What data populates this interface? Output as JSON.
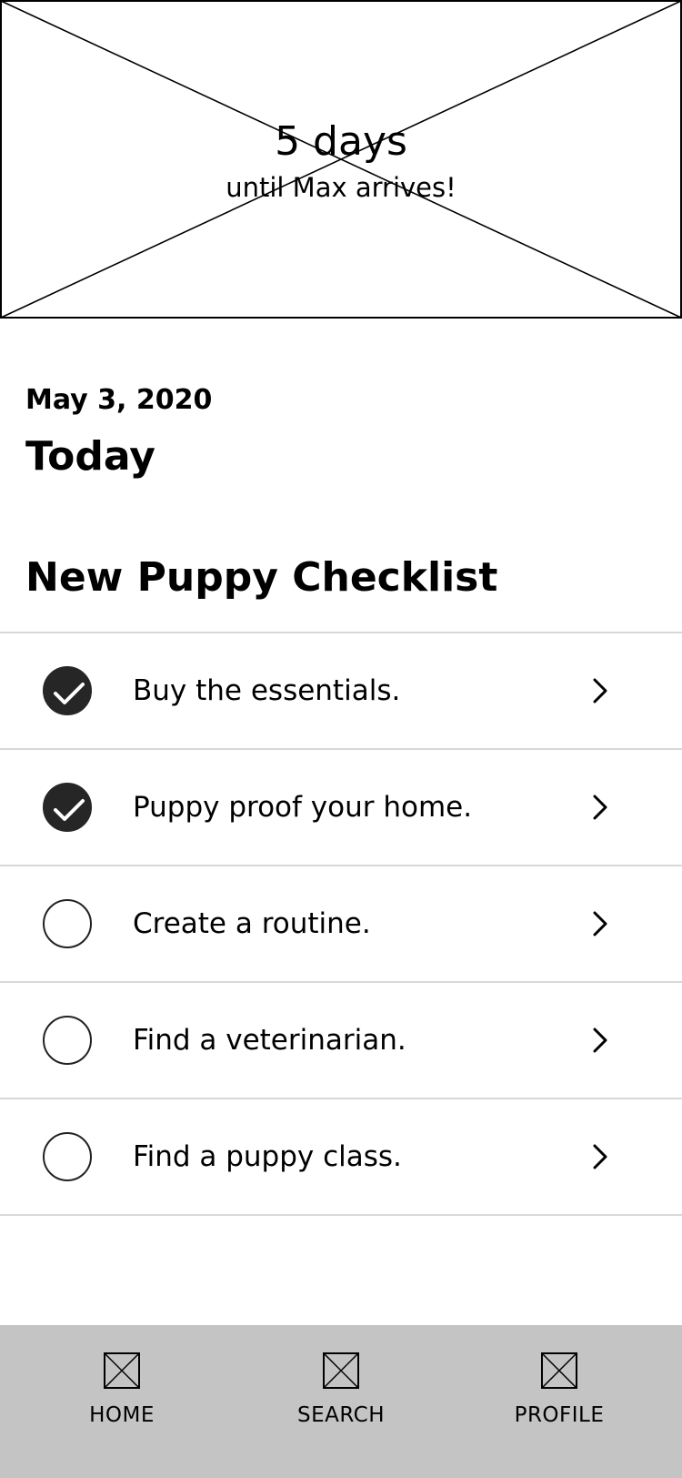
{
  "hero": {
    "countdown": "5 days",
    "subtitle": "until Max arrives!"
  },
  "date": "May 3, 2020",
  "today_heading": "Today",
  "checklist": {
    "title": "New Puppy Checklist",
    "items": [
      {
        "label": "Buy the essentials.",
        "completed": true
      },
      {
        "label": "Puppy proof your home.",
        "completed": true
      },
      {
        "label": "Create a routine.",
        "completed": false
      },
      {
        "label": "Find a veterinarian.",
        "completed": false
      },
      {
        "label": "Find a puppy class.",
        "completed": false
      }
    ]
  },
  "nav": {
    "items": [
      {
        "label": "HOME",
        "icon": "image-placeholder-icon"
      },
      {
        "label": "SEARCH",
        "icon": "image-placeholder-icon"
      },
      {
        "label": "PROFILE",
        "icon": "image-placeholder-icon"
      }
    ]
  },
  "colors": {
    "nav_background": "#c4c4c4",
    "check_fill": "#262626",
    "divider": "#d8d8d8"
  }
}
